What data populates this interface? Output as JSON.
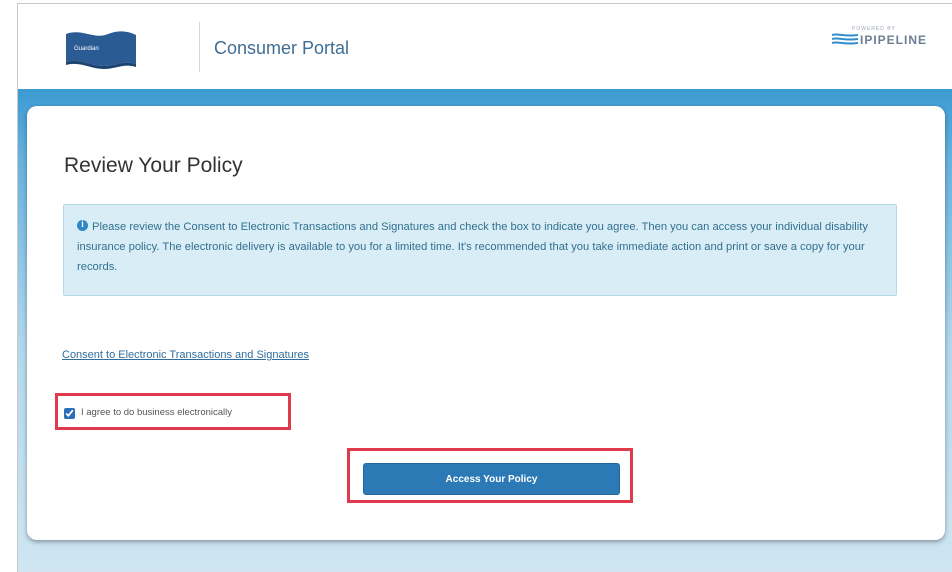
{
  "header": {
    "logo_text": "Guardian",
    "portal_title": "Consumer Portal",
    "pipeline_small": "POWERED BY",
    "pipeline_word": "IPIPELINE"
  },
  "card": {
    "title": "Review Your Policy",
    "info_message": "Please review the Consent to Electronic Transactions and Signatures and check the box to indicate you agree. Then you can access your individual disability insurance policy. The electronic delivery is available to you for a limited time. It's recommended that you take immediate action and print or save a copy for your records.",
    "consent_link": "Consent to Electronic Transactions and Signatures",
    "agree_label": "I agree to do business electronically",
    "agree_checked": true,
    "access_button": "Access Your Policy"
  },
  "colors": {
    "accent": "#2b7ab6",
    "highlight": "#e03a4d",
    "band": "#3b9ad2",
    "info_bg": "#d9edf7"
  },
  "icons": {
    "info": "info-icon",
    "logo": "flag-logo-icon"
  }
}
